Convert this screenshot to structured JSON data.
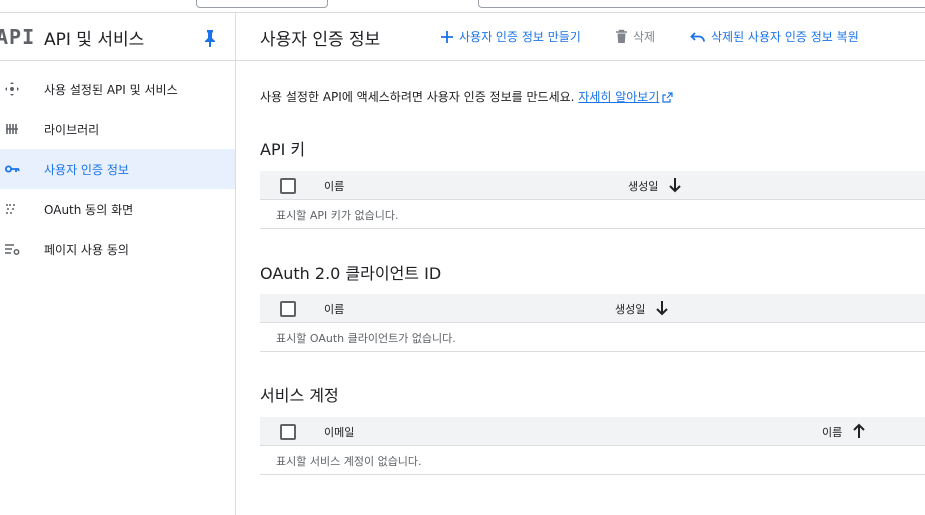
{
  "sidebar": {
    "logo": "API",
    "title": "API 및 서비스",
    "items": [
      {
        "label": "사용 설정된 API 및 서비스",
        "icon": "diamond-arrows-icon",
        "active": false
      },
      {
        "label": "라이브러리",
        "icon": "library-icon",
        "active": false
      },
      {
        "label": "사용자 인증 정보",
        "icon": "key-icon",
        "active": true
      },
      {
        "label": "OAuth 동의 화면",
        "icon": "oauth-dots-icon",
        "active": false
      },
      {
        "label": "페이지 사용 동의",
        "icon": "settings-list-icon",
        "active": false
      }
    ]
  },
  "header": {
    "title": "사용자 인증 정보",
    "create_label": "사용자 인증 정보 만들기",
    "delete_label": "삭제",
    "restore_label": "삭제된 사용자 인증 정보 복원"
  },
  "intro": {
    "text": "사용 설정한 API에 액세스하려면 사용자 인증 정보를 만드세요.",
    "link": "자세히 알아보기"
  },
  "api_keys": {
    "title": "API 키",
    "col_name": "이름",
    "col_created": "생성일",
    "empty": "표시할 API 키가 없습니다."
  },
  "oauth": {
    "title": "OAuth 2.0 클라이언트 ID",
    "col_name": "이름",
    "col_created": "생성일",
    "empty": "표시할 OAuth 클라이언트가 없습니다."
  },
  "service_accounts": {
    "title": "서비스 계정",
    "col_email": "이메일",
    "col_name": "이름",
    "empty": "표시할 서비스 계정이 없습니다."
  },
  "colors": {
    "accent": "#1a73e8",
    "active_bg": "#e8f0fe",
    "header_bg": "#f1f3f4",
    "divider": "#dadce0"
  }
}
